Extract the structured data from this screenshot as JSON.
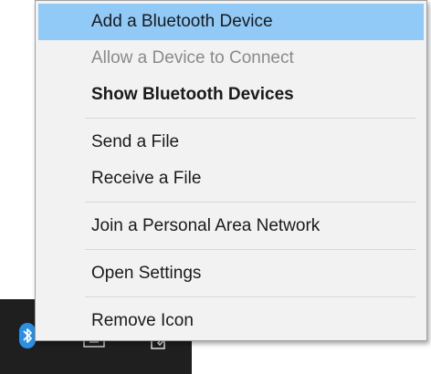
{
  "menu": {
    "items": [
      {
        "label": "Add a Bluetooth Device"
      },
      {
        "label": "Allow a Device to Connect"
      },
      {
        "label": "Show Bluetooth Devices"
      },
      {
        "label": "Send a File"
      },
      {
        "label": "Receive a File"
      },
      {
        "label": "Join a Personal Area Network"
      },
      {
        "label": "Open Settings"
      },
      {
        "label": "Remove Icon"
      }
    ]
  },
  "taskbar": {
    "icons": [
      "bluetooth-icon",
      "keyboard-icon",
      "notes-icon"
    ]
  },
  "colors": {
    "highlight": "#91c9f7",
    "menu_bg": "#f2f2f2",
    "disabled_text": "#8a8a8a",
    "taskbar_bg": "#1f1f1f",
    "bluetooth_blue": "#2b8fe6"
  }
}
